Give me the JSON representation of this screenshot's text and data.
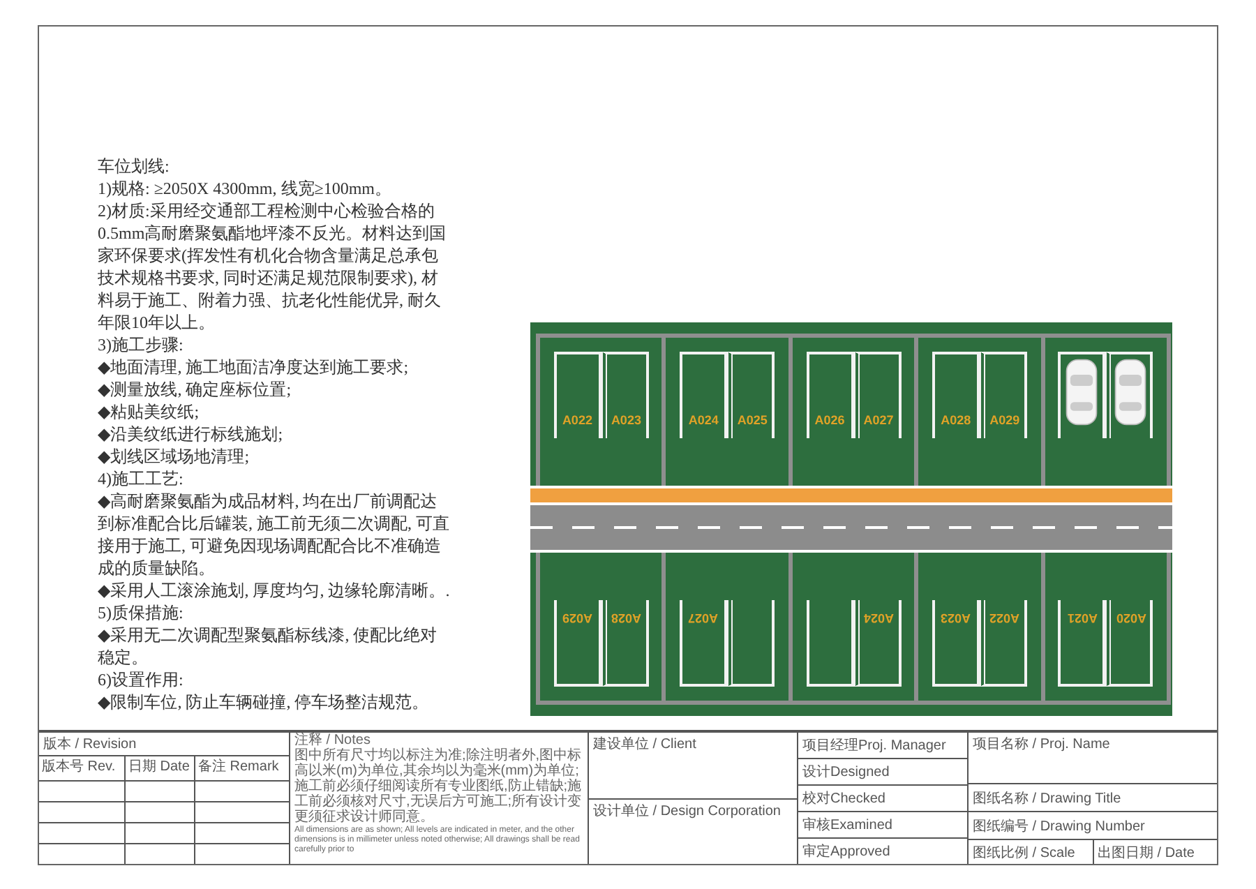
{
  "notes": {
    "heading": "车位划线:",
    "paragraphs": [
      "1)规格: ≥2050X 4300mm, 线宽≥100mm。",
      "2)材质:采用经交通部工程检测中心检验合格的0.5mm高耐磨聚氨酯地坪漆不反光。材料达到国家环保要求(挥发性有机化合物含量满足总承包技术规格书要求, 同时还满足规范限制要求), 材料易于施工、附着力强、抗老化性能优异, 耐久年限10年以上。",
      "3)施工步骤:",
      "◆地面清理, 施工地面洁净度达到施工要求;",
      "◆测量放线, 确定座标位置;",
      "◆粘贴美纹纸;",
      "◆沿美纹纸进行标线施划;",
      "◆划线区域场地清理;",
      "4)施工工艺:",
      "◆高耐磨聚氨酯为成品材料, 均在出厂前调配达到标准配合比后罐装, 施工前无须二次调配, 可直接用于施工, 可避免因现场调配配合比不准确造成的质量缺陷。",
      "◆采用人工滚涂施划, 厚度均匀, 边缘轮廓清晰。.",
      "5)质保措施:",
      "◆采用无二次调配型聚氨酯标线漆, 使配比绝对稳定。",
      "6)设置作用:",
      "◆限制车位, 防止车辆碰撞, 停车场整洁规范。"
    ]
  },
  "plan": {
    "top_bays": [
      {
        "stalls": [
          {
            "kind": "label",
            "label": "A022"
          },
          {
            "kind": "label",
            "label": "A023"
          }
        ]
      },
      {
        "stalls": [
          {
            "kind": "label",
            "label": "A024"
          },
          {
            "kind": "label",
            "label": "A025"
          }
        ]
      },
      {
        "stalls": [
          {
            "kind": "label",
            "label": "A026"
          },
          {
            "kind": "label",
            "label": "A027"
          }
        ]
      },
      {
        "stalls": [
          {
            "kind": "label",
            "label": "A028"
          },
          {
            "kind": "label",
            "label": "A029"
          }
        ]
      },
      {
        "stalls": [
          {
            "kind": "car"
          },
          {
            "kind": "car"
          }
        ]
      }
    ],
    "bottom_bays": [
      {
        "stalls": [
          {
            "kind": "label",
            "label": "A029"
          },
          {
            "kind": "label",
            "label": "A028"
          }
        ]
      },
      {
        "stalls": [
          {
            "kind": "label",
            "label": "A027"
          },
          {
            "kind": "empty"
          }
        ]
      },
      {
        "stalls": [
          {
            "kind": "empty"
          },
          {
            "kind": "label",
            "label": "A024"
          }
        ]
      },
      {
        "stalls": [
          {
            "kind": "label",
            "label": "A023"
          },
          {
            "kind": "label",
            "label": "A022"
          }
        ]
      },
      {
        "stalls": [
          {
            "kind": "label",
            "label": "A021"
          },
          {
            "kind": "label",
            "label": "A020"
          }
        ]
      }
    ]
  },
  "title_block": {
    "revision": {
      "title": "版本 / Revision",
      "columns": [
        "版本号 Rev.",
        "日期 Date",
        "备注 Remark"
      ]
    },
    "notes": {
      "title": "注释 / Notes",
      "text": "图中所有尺寸均以标注为准;除注明者外,图中标高以米(m)为单位,其余均以为毫米(mm)为单位;施工前必须仔细阅读所有专业图纸,防止错缺;施工前必须核对尺寸,无误后方可施工;所有设计变更须征求设计师同意。",
      "english": "All dimensions are as shown; All levels are indicated in meter, and the other dimensions is in millimeter unless noted otherwise; All drawings shall be read carefully prior to"
    },
    "client": "建设单位 / Client",
    "design": "设计单位 / Design Corporation",
    "roles": [
      "项目经理Proj. Manager",
      "设计Designed",
      "校对Checked",
      "审核Examined",
      "审定Approved"
    ],
    "project_name": "项目名称 / Proj. Name",
    "drawing_title": "图纸名称 / Drawing Title",
    "drawing_number": "图纸编号 / Drawing Number",
    "scale": "图纸比例 / Scale",
    "date": "出图日期 / Date"
  }
}
